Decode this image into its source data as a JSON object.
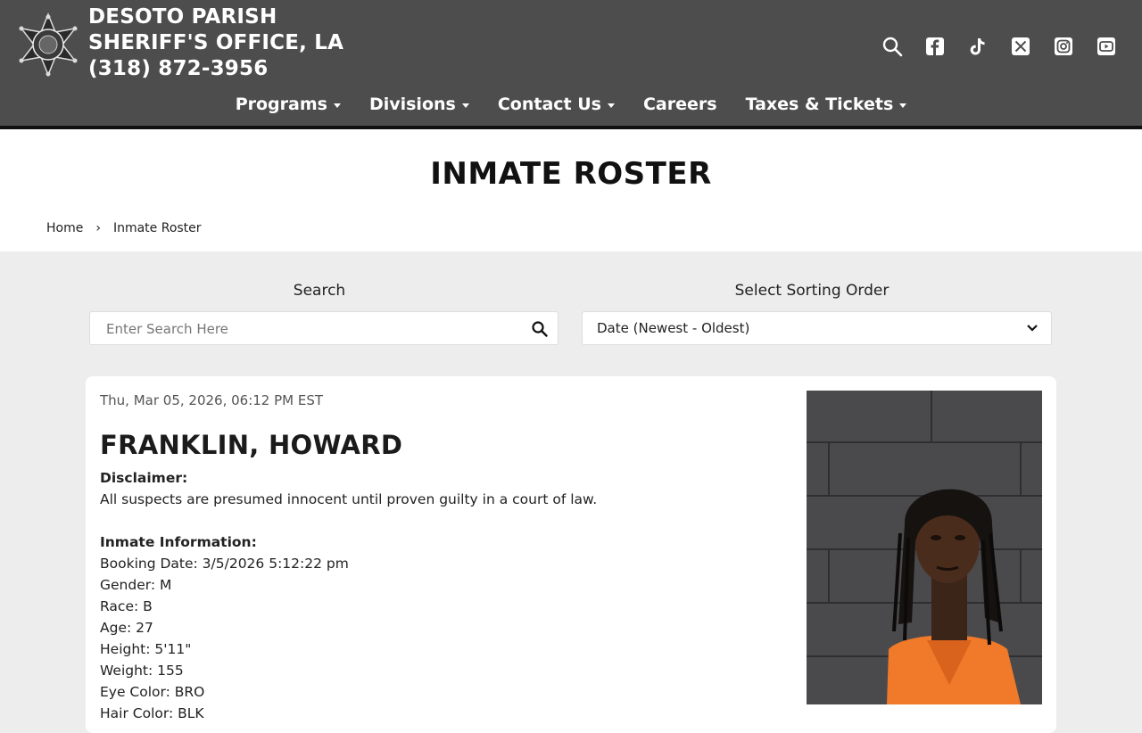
{
  "header": {
    "org_line1": "DESOTO PARISH",
    "org_line2": "SHERIFF'S OFFICE, LA",
    "phone": "(318) 872-3956",
    "icons": [
      "search-icon",
      "facebook-icon",
      "tiktok-icon",
      "x-twitter-icon",
      "instagram-icon",
      "youtube-icon"
    ]
  },
  "nav": [
    {
      "label": "Programs"
    },
    {
      "label": "Divisions"
    },
    {
      "label": "Contact Us"
    },
    {
      "label": "Careers"
    },
    {
      "label": "Taxes & Tickets"
    }
  ],
  "page": {
    "title": "INMATE ROSTER",
    "breadcrumb_home": "Home",
    "breadcrumb_sep": "›",
    "breadcrumb_current": "Inmate Roster"
  },
  "filters": {
    "search_label": "Search",
    "search_placeholder": "Enter Search Here",
    "sort_label": "Select Sorting Order",
    "sort_value": "Date (Newest - Oldest)"
  },
  "record": {
    "date": "Thu, Mar 05, 2026, 06:12 PM EST",
    "name": "FRANKLIN, HOWARD",
    "disclaimer_heading": "Disclaimer:",
    "disclaimer_text": "All suspects are presumed innocent until proven guilty in a court of law.",
    "info_heading": "Inmate Information:",
    "booking_date": "Booking Date: 3/5/2026 5:12:22 pm",
    "gender": "Gender: M",
    "race": "Race: B",
    "age": "Age: 27",
    "height": "Height: 5'11\"",
    "weight": "Weight: 155",
    "eye_color": "Eye Color: BRO",
    "hair_color": "Hair Color: BLK"
  },
  "colors": {
    "header_bg": "#4d4d4d",
    "page_bg": "#ededed",
    "jumpsuit": "#f07a2a"
  }
}
